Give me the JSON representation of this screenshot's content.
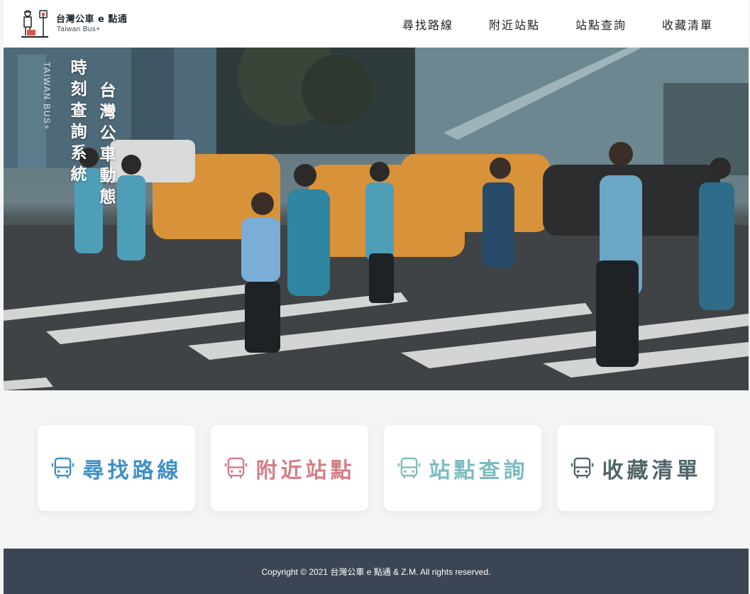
{
  "brand": {
    "title": "台灣公車 e 點通",
    "subtitle": "Taiwan Bus+"
  },
  "nav": {
    "items": [
      {
        "label": "尋找路線"
      },
      {
        "label": "附近站點"
      },
      {
        "label": "站點查詢"
      },
      {
        "label": "收藏清單"
      }
    ]
  },
  "hero": {
    "english": "TAIWAN BUS+",
    "line1": "時刻查詢系統",
    "line2": "台灣公車動態"
  },
  "cards": [
    {
      "label": "尋找路線",
      "color": "#3f8fc6",
      "icon": "bus-icon"
    },
    {
      "label": "附近站點",
      "color": "#d47e86",
      "icon": "bus-icon"
    },
    {
      "label": "站點查詢",
      "color": "#7cbcc0",
      "icon": "bus-icon"
    },
    {
      "label": "收藏清單",
      "color": "#4f6669",
      "icon": "bus-icon"
    }
  ],
  "footer": {
    "copyright": "Copyright © 2021 台灣公車 e 點通 & Z.M. All rights reserved."
  }
}
